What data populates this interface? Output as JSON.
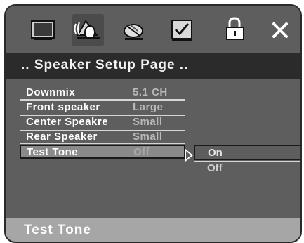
{
  "icons": [
    "monitor-icon",
    "speaker-icon",
    "disc-icon",
    "checklist-icon",
    "lock-icon",
    "close-icon"
  ],
  "page_title": ".. Speaker Setup Page ..",
  "menu": {
    "items": [
      {
        "label": "Downmix",
        "value": "5.1 CH"
      },
      {
        "label": "Front speaker",
        "value": "Large"
      },
      {
        "label": "Center Speakre",
        "value": "Small"
      },
      {
        "label": "Rear Speaker",
        "value": "Small"
      },
      {
        "label": "Test  Tone",
        "value": "Off"
      }
    ],
    "selected": "Test  Tone"
  },
  "submenu": {
    "options": [
      "On",
      "Off"
    ],
    "highlighted": "On"
  },
  "status_text": "Test Tone",
  "colors": {
    "panel": "#5e5e5e",
    "title_bar": "#2b2b2b",
    "status_bar": "#a6a6a6"
  }
}
